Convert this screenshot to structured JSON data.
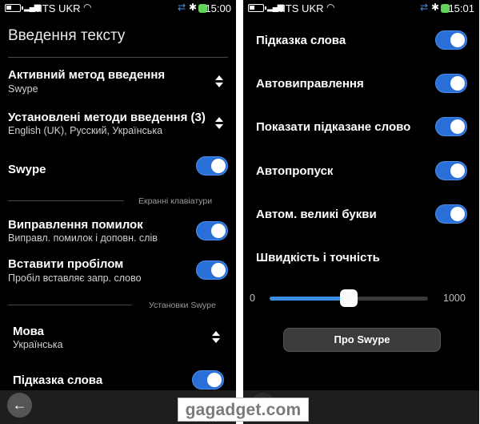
{
  "status_left": {
    "carrier": "MTS UKR",
    "time": "15:00"
  },
  "status_right": {
    "carrier": "MTS UKR",
    "time": "15:01"
  },
  "left_screen": {
    "title": "Введення тексту",
    "active_method": {
      "title": "Активний метод введення",
      "value": "Swype"
    },
    "installed_methods": {
      "title": "Установлені методи введення (3)",
      "value": "English (UK), Русский, Українська"
    },
    "swype": {
      "title": "Swype",
      "enabled": true
    },
    "section_keyboards": "Екранні клавіатури",
    "error_correction": {
      "title": "Виправлення помилок",
      "sub": "Виправл. помилок і доповн. слів",
      "enabled": true
    },
    "space_insert": {
      "title": "Вставити пробілом",
      "sub": "Пробіл вставляє запр. слово",
      "enabled": true
    },
    "section_swype": "Установки Swype",
    "language": {
      "title": "Мова",
      "value": "Українська"
    },
    "word_hint": {
      "title": "Підказка слова",
      "enabled": true
    },
    "back_icon": "back-arrow-icon"
  },
  "right_screen": {
    "word_hint": {
      "title": "Підказка слова",
      "enabled": true
    },
    "auto_correct": {
      "title": "Автовиправлення",
      "enabled": true
    },
    "show_suggested": {
      "title": "Показати підказане слово",
      "enabled": true
    },
    "auto_space": {
      "title": "Автопропуск",
      "enabled": true
    },
    "auto_caps": {
      "title": "Автом. великі букви",
      "enabled": true
    },
    "speed_accuracy": {
      "title": "Швидкість і точність",
      "min_label": "0",
      "max_label": "1000",
      "value_fraction": 0.5
    },
    "about_button": "Про Swype"
  },
  "watermark": "gagadget.com",
  "colors": {
    "toggle_on": "#2a6fd8",
    "slider_fill": "#3a8ee6",
    "battery_green": "#5fd65a"
  }
}
